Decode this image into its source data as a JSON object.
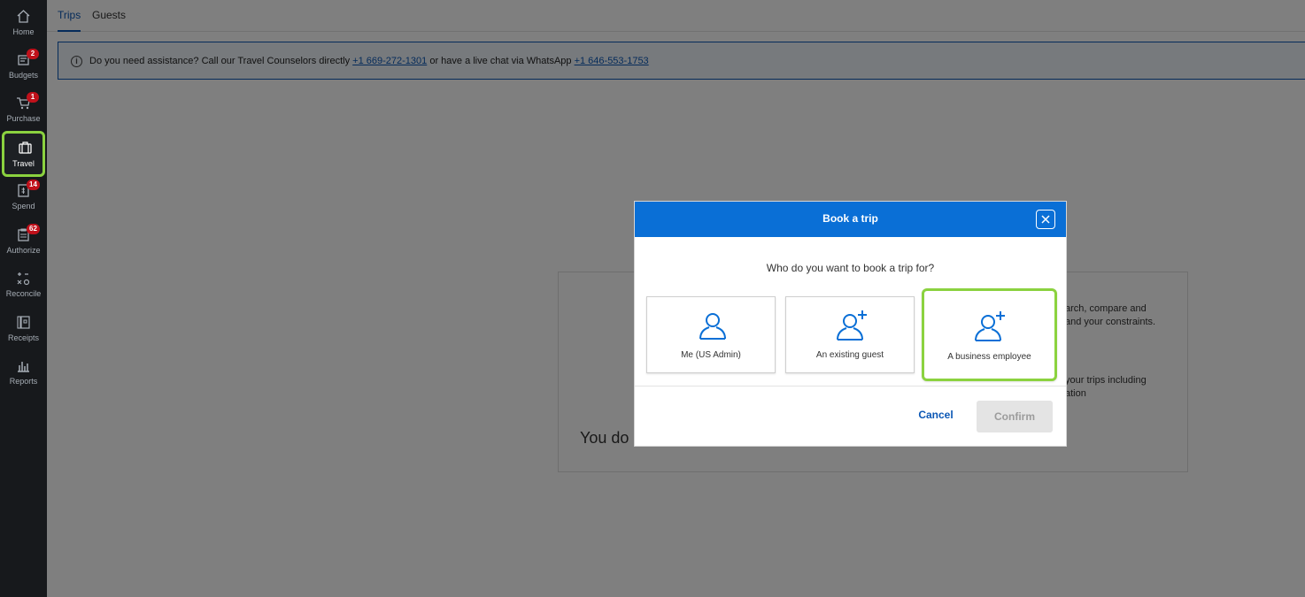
{
  "sidebar": {
    "items": [
      {
        "label": "Home",
        "icon": "home-icon",
        "badge": ""
      },
      {
        "label": "Budgets",
        "icon": "budgets-icon",
        "badge": "2"
      },
      {
        "label": "Purchase",
        "icon": "cart-icon",
        "badge": "1"
      },
      {
        "label": "Travel",
        "icon": "suitcase-icon",
        "badge": ""
      },
      {
        "label": "Spend",
        "icon": "spend-icon",
        "badge": "14"
      },
      {
        "label": "Authorize",
        "icon": "clipboard-icon",
        "badge": "62"
      },
      {
        "label": "Reconcile",
        "icon": "reconcile-icon",
        "badge": ""
      },
      {
        "label": "Receipts",
        "icon": "receipt-icon",
        "badge": ""
      },
      {
        "label": "Reports",
        "icon": "chart-icon",
        "badge": ""
      }
    ]
  },
  "tabs": [
    {
      "label": "Trips"
    },
    {
      "label": "Guests"
    }
  ],
  "banner": {
    "text_before": "Do you need assistance? Call our Travel Counselors directly ",
    "phone1": "+1 669-272-1301",
    "text_middle": " or have a live chat via WhatsApp ",
    "phone2": "+1 646-553-1753"
  },
  "background_card": {
    "frag1": "arch, compare and",
    "frag2": "and your constraints.",
    "frag3": "your trips including",
    "frag4": "ation",
    "big_text": "You do"
  },
  "modal": {
    "title": "Book a trip",
    "question": "Who do you want to book a trip for?",
    "options": [
      {
        "label": "Me (US Admin)",
        "icon": "person-icon"
      },
      {
        "label": "An existing guest",
        "icon": "person-add-icon"
      },
      {
        "label": "A business employee",
        "icon": "person-add-icon"
      }
    ],
    "cancel_label": "Cancel",
    "confirm_label": "Confirm"
  },
  "colors": {
    "brand_blue": "#0a6fd6",
    "highlight_green": "#8bd23f",
    "sidebar_bg": "#17191c",
    "badge_red": "#c0111b"
  }
}
